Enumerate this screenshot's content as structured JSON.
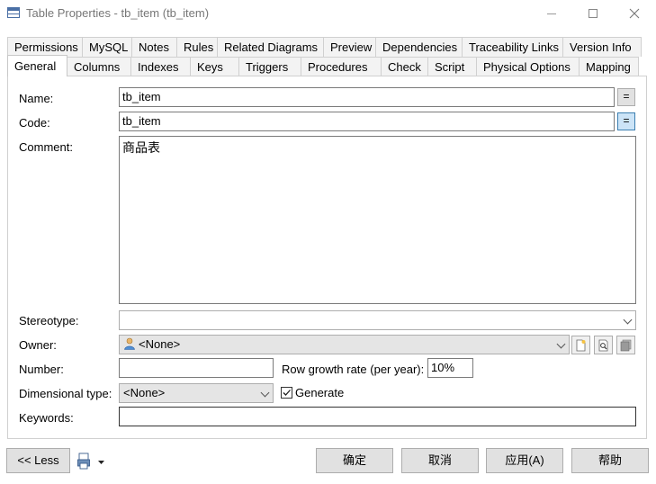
{
  "window": {
    "title": "Table Properties - tb_item (tb_item)"
  },
  "tabs": {
    "row1": [
      "Permissions",
      "MySQL",
      "Notes",
      "Rules",
      "Related Diagrams",
      "Preview",
      "Dependencies",
      "Traceability Links",
      "Version Info"
    ],
    "row2": [
      "General",
      "Columns",
      "Indexes",
      "Keys",
      "Triggers",
      "Procedures",
      "Check",
      "Script",
      "Physical Options",
      "Mapping"
    ],
    "active": "General"
  },
  "form": {
    "name_label": "Name:",
    "name_value": "tb_item",
    "code_label": "Code:",
    "code_value": "tb_item",
    "eq_label": "=",
    "comment_label": "Comment:",
    "comment_value": "商品表",
    "stereotype_label": "Stereotype:",
    "stereotype_value": "",
    "owner_label": "Owner:",
    "owner_value": "<None>",
    "number_label": "Number:",
    "number_value": "",
    "row_growth_label": "Row growth rate (per year):",
    "row_growth_value": "10%",
    "dimensional_label": "Dimensional type:",
    "dimensional_value": "<None>",
    "generate_label": "Generate",
    "generate_checked": true,
    "keywords_label": "Keywords:",
    "keywords_value": ""
  },
  "footer": {
    "less_label": "<< Less",
    "ok_label": "确定",
    "cancel_label": "取消",
    "apply_label": "应用(A)",
    "help_label": "帮助"
  },
  "icons": {
    "window": "table-icon",
    "owner": "user-icon",
    "print": "printer-icon"
  }
}
